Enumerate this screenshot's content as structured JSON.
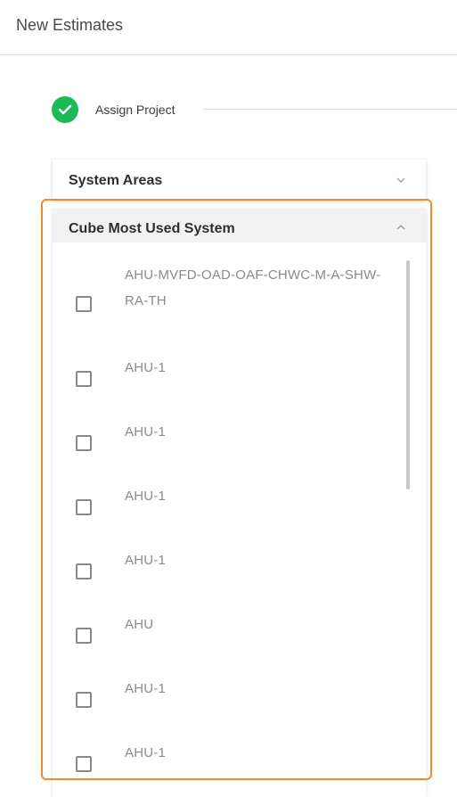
{
  "header": {
    "title": "New Estimates"
  },
  "stepper": {
    "step_label": "Assign Project",
    "step_icon": "check-icon",
    "step_color": "#1db954"
  },
  "panels": {
    "system_areas": {
      "title": "System Areas",
      "icon": "chevron-down-icon"
    },
    "cube_most_used": {
      "title": "Cube Most Used System",
      "icon": "chevron-up-icon"
    }
  },
  "systems": [
    {
      "label": "AHU-MVFD-OAD-OAF-CHWC-M-A-SHW-RA-TH",
      "checked": false
    },
    {
      "label": "AHU-1",
      "checked": false
    },
    {
      "label": "AHU-1",
      "checked": false
    },
    {
      "label": "AHU-1",
      "checked": false
    },
    {
      "label": "AHU-1",
      "checked": false
    },
    {
      "label": "AHU",
      "checked": false
    },
    {
      "label": "AHU-1",
      "checked": false
    },
    {
      "label": "AHU-1",
      "checked": false
    }
  ],
  "colors": {
    "focus_outline": "#f08c2a",
    "header_bg": "#f2f2f2"
  }
}
